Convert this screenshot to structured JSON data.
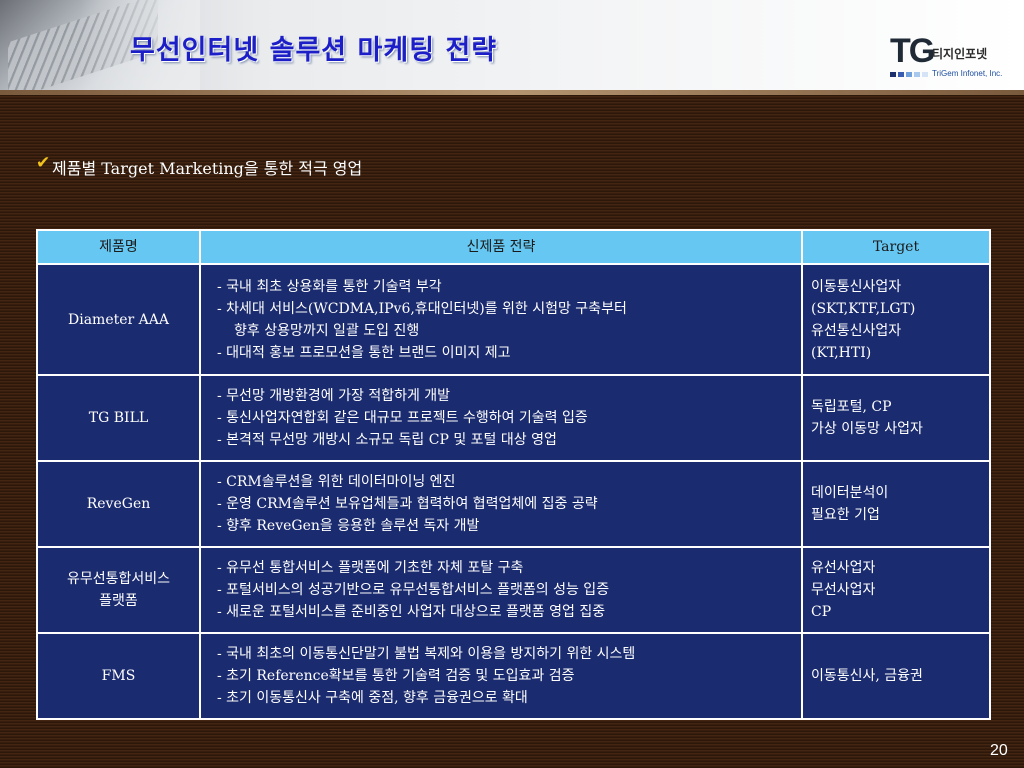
{
  "header": {
    "title": "무선인터넷 솔루션 마케팅 전략",
    "logo": {
      "mark": "TG",
      "name_ko": "티지인포넷",
      "name_en": "TriGem Infonet, Inc.",
      "bar_colors": [
        "#1e2f6e",
        "#3a5cb0",
        "#6fa0dc",
        "#a8c8ee",
        "#d4e4f6"
      ]
    }
  },
  "subtitle": {
    "icon": "checkmark-icon",
    "text": "제품별 Target Marketing을 통한 적극 영업"
  },
  "colors": {
    "header_row": "#66c8f2",
    "cell_background": "#1b2b6f",
    "title": "#1c1ec7",
    "checkmark": "#f1c21b"
  },
  "table": {
    "headers": [
      "제품명",
      "신제품 전략",
      "Target"
    ],
    "rows": [
      {
        "name": [
          "Diameter AAA"
        ],
        "strategy": [
          "- 국내 최초 상용화를 통한 기술력 부각",
          "- 차세대 서비스(WCDMA,IPv6,휴대인터넷)를 위한 시험망 구축부터",
          "향후 상용망까지 일괄 도입 진행",
          "- 대대적 홍보 프로모션을 통한 브랜드 이미지 제고"
        ],
        "target": [
          "이동통신사업자",
          "(SKT,KTF,LGT)",
          "유선통신사업자",
          "(KT,HTI)"
        ]
      },
      {
        "name": [
          "TG BILL"
        ],
        "strategy": [
          "- 무선망 개방환경에 가장 적합하게 개발",
          "- 통신사업자연합회 같은 대규모 프로젝트 수행하여 기술력 입증",
          "- 본격적 무선망 개방시 소규모 독립 CP 및 포털 대상 영업"
        ],
        "target": [
          "독립포털, CP",
          "가상 이동망 사업자"
        ]
      },
      {
        "name": [
          "ReveGen"
        ],
        "strategy": [
          "- CRM솔루션을 위한 데이터마이닝 엔진",
          "- 운영 CRM솔루션 보유업체들과 협력하여 협력업체에 집중 공략",
          "- 향후 ReveGen을 응용한 솔루션 독자 개발"
        ],
        "target": [
          "데이터분석이",
          "필요한 기업"
        ]
      },
      {
        "name": [
          "유무선통합서비스",
          "플랫폼"
        ],
        "strategy": [
          "- 유무선 통합서비스 플랫폼에 기초한 자체 포탈 구축",
          "- 포털서비스의 성공기반으로 유무선통합서비스 플랫폼의 성능 입증",
          "- 새로운 포털서비스를 준비중인 사업자 대상으로 플랫폼 영업 집중"
        ],
        "target": [
          "유선사업자",
          "무선사업자",
          "CP"
        ]
      },
      {
        "name": [
          "FMS"
        ],
        "strategy": [
          "- 국내 최초의 이동통신단말기 불법 복제와 이용을 방지하기 위한 시스템",
          "- 초기 Reference확보를 통한 기술력 검증 및 도입효과 검증",
          "- 초기 이동통신사 구축에 중점, 향후 금융권으로 확대"
        ],
        "target": [
          "이동통신사, 금융권"
        ]
      }
    ]
  },
  "page_number": "20"
}
